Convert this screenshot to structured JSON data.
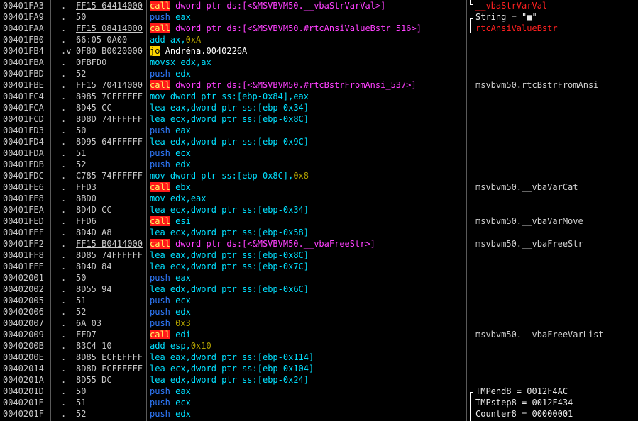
{
  "colors": {
    "background": "#000000",
    "call_highlight": "#ff1a1a",
    "jump_highlight": "#ffd400",
    "push_text": "#2f7bff",
    "operand_text": "#00e0ff",
    "pink_text": "#ff40ff",
    "comment_red": "#ff2020"
  },
  "rows": [
    {
      "addr": "00401FA3",
      "mark": ".",
      "hex": "FF15 64414000",
      "hex_ul": true,
      "mn": "call",
      "mn_class": "mn-call",
      "op": "dword ptr ds:[<&MSVBVM50.__vbaStrVarVal>]",
      "op_class": "op-pink",
      "com": "__vbaStrVarVal",
      "com_class": "red"
    },
    {
      "addr": "00401FA9",
      "mark": ".",
      "hex": "50",
      "hex_ul": false,
      "mn": "push",
      "mn_class": "mn-push",
      "op": "eax",
      "op_class": "op-data",
      "com": "String = \"■\"",
      "com_class": "wht"
    },
    {
      "addr": "00401FAA",
      "mark": ".",
      "hex": "FF15 08414000",
      "hex_ul": true,
      "mn": "call",
      "mn_class": "mn-call",
      "op": "dword ptr ds:[<&MSVBVM50.#rtcAnsiValueBstr_516>]",
      "op_class": "op-pink",
      "com": "rtcAnsiValueBstr",
      "com_class": "red"
    },
    {
      "addr": "00401FB0",
      "mark": ".",
      "hex": "66:05 0A00",
      "hex_ul": false,
      "mn": "add",
      "mn_class": "mn-data",
      "op": "ax,",
      "op_class": "op-data",
      "imm": "0xA",
      "com": "",
      "com_class": ""
    },
    {
      "addr": "00401FB4",
      "mark": ".v",
      "hex": "0F80 B0020000",
      "hex_ul": false,
      "mn": "jo",
      "mn_class": "mn-jcc",
      "op": "Andréna.0040226A",
      "op_class": "op-white",
      "com": "",
      "com_class": ""
    },
    {
      "addr": "00401FBA",
      "mark": ".",
      "hex": "0FBFD0",
      "hex_ul": false,
      "mn": "movsx",
      "mn_class": "mn-data",
      "op": "edx,ax",
      "op_class": "op-data",
      "com": "",
      "com_class": ""
    },
    {
      "addr": "00401FBD",
      "mark": ".",
      "hex": "52",
      "hex_ul": false,
      "mn": "push",
      "mn_class": "mn-push",
      "op": "edx",
      "op_class": "op-data",
      "com": "",
      "com_class": ""
    },
    {
      "addr": "00401FBE",
      "mark": ".",
      "hex": "FF15 70414000",
      "hex_ul": true,
      "mn": "call",
      "mn_class": "mn-call",
      "op": "dword ptr ds:[<&MSVBVM50.#rtcBstrFromAnsi_537>]",
      "op_class": "op-pink",
      "com": "msvbvm50.rtcBstrFromAnsi",
      "com_class": ""
    },
    {
      "addr": "00401FC4",
      "mark": ".",
      "hex": "8985 7CFFFFFF",
      "hex_ul": false,
      "mn": "mov",
      "mn_class": "mn-data",
      "op": "dword ptr ss:[ebp-0x84],eax",
      "op_class": "op-data",
      "com": "",
      "com_class": ""
    },
    {
      "addr": "00401FCA",
      "mark": ".",
      "hex": "8D45 CC",
      "hex_ul": false,
      "mn": "lea",
      "mn_class": "mn-data",
      "op": "eax,dword ptr ss:[ebp-0x34]",
      "op_class": "op-data",
      "com": "",
      "com_class": ""
    },
    {
      "addr": "00401FCD",
      "mark": ".",
      "hex": "8D8D 74FFFFFF",
      "hex_ul": false,
      "mn": "lea",
      "mn_class": "mn-data",
      "op": "ecx,dword ptr ss:[ebp-0x8C]",
      "op_class": "op-data",
      "com": "",
      "com_class": ""
    },
    {
      "addr": "00401FD3",
      "mark": ".",
      "hex": "50",
      "hex_ul": false,
      "mn": "push",
      "mn_class": "mn-push",
      "op": "eax",
      "op_class": "op-data",
      "com": "",
      "com_class": ""
    },
    {
      "addr": "00401FD4",
      "mark": ".",
      "hex": "8D95 64FFFFFF",
      "hex_ul": false,
      "mn": "lea",
      "mn_class": "mn-data",
      "op": "edx,dword ptr ss:[ebp-0x9C]",
      "op_class": "op-data",
      "com": "",
      "com_class": ""
    },
    {
      "addr": "00401FDA",
      "mark": ".",
      "hex": "51",
      "hex_ul": false,
      "mn": "push",
      "mn_class": "mn-push",
      "op": "ecx",
      "op_class": "op-data",
      "com": "",
      "com_class": ""
    },
    {
      "addr": "00401FDB",
      "mark": ".",
      "hex": "52",
      "hex_ul": false,
      "mn": "push",
      "mn_class": "mn-push",
      "op": "edx",
      "op_class": "op-data",
      "com": "",
      "com_class": ""
    },
    {
      "addr": "00401FDC",
      "mark": ".",
      "hex": "C785 74FFFFFF",
      "hex_ul": false,
      "mn": "mov",
      "mn_class": "mn-data",
      "op": "dword ptr ss:[ebp-0x8C],",
      "op_class": "op-data",
      "imm": "0x8",
      "com": "",
      "com_class": ""
    },
    {
      "addr": "00401FE6",
      "mark": ".",
      "hex": "FFD3",
      "hex_ul": false,
      "mn": "call",
      "mn_class": "mn-call",
      "op": "ebx",
      "op_class": "op-data",
      "com": "msvbvm50.__vbaVarCat",
      "com_class": ""
    },
    {
      "addr": "00401FE8",
      "mark": ".",
      "hex": "8BD0",
      "hex_ul": false,
      "mn": "mov",
      "mn_class": "mn-data",
      "op": "edx,eax",
      "op_class": "op-data",
      "com": "",
      "com_class": ""
    },
    {
      "addr": "00401FEA",
      "mark": ".",
      "hex": "8D4D CC",
      "hex_ul": false,
      "mn": "lea",
      "mn_class": "mn-data",
      "op": "ecx,dword ptr ss:[ebp-0x34]",
      "op_class": "op-data",
      "com": "",
      "com_class": ""
    },
    {
      "addr": "00401FED",
      "mark": ".",
      "hex": "FFD6",
      "hex_ul": false,
      "mn": "call",
      "mn_class": "mn-call",
      "op": "esi",
      "op_class": "op-data",
      "com": "msvbvm50.__vbaVarMove",
      "com_class": ""
    },
    {
      "addr": "00401FEF",
      "mark": ".",
      "hex": "8D4D A8",
      "hex_ul": false,
      "mn": "lea",
      "mn_class": "mn-data",
      "op": "ecx,dword ptr ss:[ebp-0x58]",
      "op_class": "op-data",
      "com": "",
      "com_class": ""
    },
    {
      "addr": "00401FF2",
      "mark": ".",
      "hex": "FF15 B0414000",
      "hex_ul": true,
      "mn": "call",
      "mn_class": "mn-call",
      "op": "dword ptr ds:[<&MSVBVM50.__vbaFreeStr>]",
      "op_class": "op-pink",
      "com": "msvbvm50.__vbaFreeStr",
      "com_class": ""
    },
    {
      "addr": "00401FF8",
      "mark": ".",
      "hex": "8D85 74FFFFFF",
      "hex_ul": false,
      "mn": "lea",
      "mn_class": "mn-data",
      "op": "eax,dword ptr ss:[ebp-0x8C]",
      "op_class": "op-data",
      "com": "",
      "com_class": ""
    },
    {
      "addr": "00401FFE",
      "mark": ".",
      "hex": "8D4D 84",
      "hex_ul": false,
      "mn": "lea",
      "mn_class": "mn-data",
      "op": "ecx,dword ptr ss:[ebp-0x7C]",
      "op_class": "op-data",
      "com": "",
      "com_class": ""
    },
    {
      "addr": "00402001",
      "mark": ".",
      "hex": "50",
      "hex_ul": false,
      "mn": "push",
      "mn_class": "mn-push",
      "op": "eax",
      "op_class": "op-data",
      "com": "",
      "com_class": ""
    },
    {
      "addr": "00402002",
      "mark": ".",
      "hex": "8D55 94",
      "hex_ul": false,
      "mn": "lea",
      "mn_class": "mn-data",
      "op": "edx,dword ptr ss:[ebp-0x6C]",
      "op_class": "op-data",
      "com": "",
      "com_class": ""
    },
    {
      "addr": "00402005",
      "mark": ".",
      "hex": "51",
      "hex_ul": false,
      "mn": "push",
      "mn_class": "mn-push",
      "op": "ecx",
      "op_class": "op-data",
      "com": "",
      "com_class": ""
    },
    {
      "addr": "00402006",
      "mark": ".",
      "hex": "52",
      "hex_ul": false,
      "mn": "push",
      "mn_class": "mn-push",
      "op": "edx",
      "op_class": "op-data",
      "com": "",
      "com_class": ""
    },
    {
      "addr": "00402007",
      "mark": ".",
      "hex": "6A 03",
      "hex_ul": false,
      "mn": "push",
      "mn_class": "mn-push",
      "op": "",
      "op_class": "op-data",
      "imm": "0x3",
      "com": "",
      "com_class": ""
    },
    {
      "addr": "00402009",
      "mark": ".",
      "hex": "FFD7",
      "hex_ul": false,
      "mn": "call",
      "mn_class": "mn-call",
      "op": "edi",
      "op_class": "op-data",
      "com": "msvbvm50.__vbaFreeVarList",
      "com_class": ""
    },
    {
      "addr": "0040200B",
      "mark": ".",
      "hex": "83C4 10",
      "hex_ul": false,
      "mn": "add",
      "mn_class": "mn-data",
      "op": "esp,",
      "op_class": "op-data",
      "imm": "0x10",
      "com": "",
      "com_class": ""
    },
    {
      "addr": "0040200E",
      "mark": ".",
      "hex": "8D85 ECFEFFFF",
      "hex_ul": false,
      "mn": "lea",
      "mn_class": "mn-data",
      "op": "eax,dword ptr ss:[ebp-0x114]",
      "op_class": "op-data",
      "com": "",
      "com_class": ""
    },
    {
      "addr": "00402014",
      "mark": ".",
      "hex": "8D8D FCFEFFFF",
      "hex_ul": false,
      "mn": "lea",
      "mn_class": "mn-data",
      "op": "ecx,dword ptr ss:[ebp-0x104]",
      "op_class": "op-data",
      "com": "",
      "com_class": ""
    },
    {
      "addr": "0040201A",
      "mark": ".",
      "hex": "8D55 DC",
      "hex_ul": false,
      "mn": "lea",
      "mn_class": "mn-data",
      "op": "edx,dword ptr ss:[ebp-0x24]",
      "op_class": "op-data",
      "com": "",
      "com_class": ""
    },
    {
      "addr": "0040201D",
      "mark": ".",
      "hex": "50",
      "hex_ul": false,
      "mn": "push",
      "mn_class": "mn-push",
      "op": "eax",
      "op_class": "op-data",
      "com": "TMPend8 = 0012F4AC",
      "com_class": "wht"
    },
    {
      "addr": "0040201E",
      "mark": ".",
      "hex": "51",
      "hex_ul": false,
      "mn": "push",
      "mn_class": "mn-push",
      "op": "ecx",
      "op_class": "op-data",
      "com": "TMPstep8 = 0012F434",
      "com_class": "wht"
    },
    {
      "addr": "0040201F",
      "mark": ".",
      "hex": "52",
      "hex_ul": false,
      "mn": "push",
      "mn_class": "mn-push",
      "op": "edx",
      "op_class": "op-data",
      "com": "Counter8 = 00000001",
      "com_class": "wht"
    }
  ]
}
